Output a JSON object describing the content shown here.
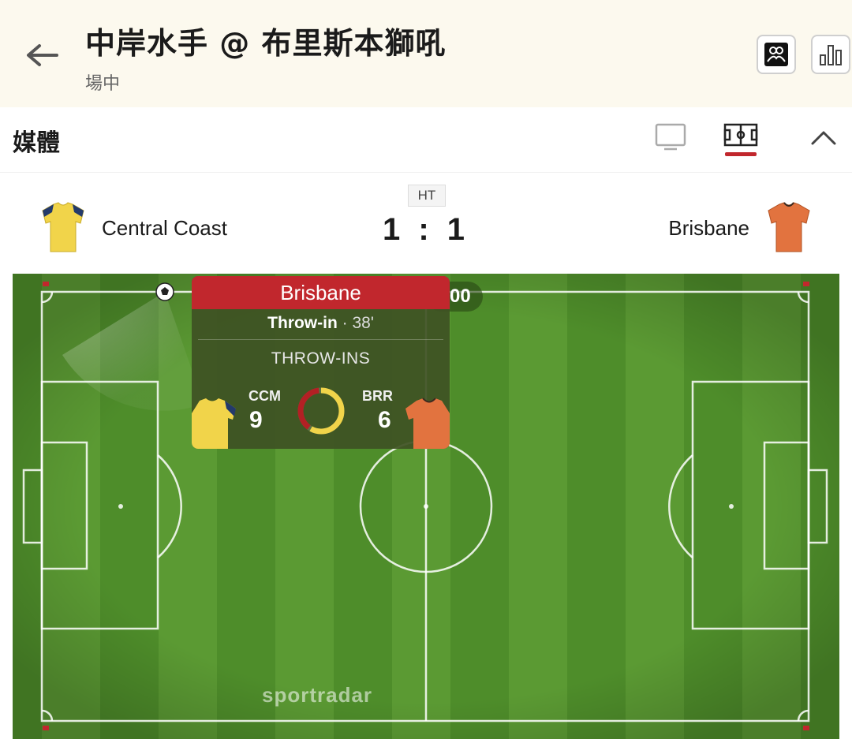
{
  "header": {
    "title": "中岸水手 @ 布里斯本獅吼",
    "status": "場中"
  },
  "header_icons": [
    "back-arrow-icon",
    "lineup-icon",
    "stats-icon"
  ],
  "media": {
    "label": "媒體",
    "icons": [
      "tv-icon",
      "pitch-view-icon",
      "chevron-up-icon"
    ],
    "active_view": "pitch-view"
  },
  "match": {
    "period": "HT",
    "home": {
      "name": "Central Coast",
      "abbr": "CCM",
      "shirt_color": "#f1d44a"
    },
    "away": {
      "name": "Brisbane",
      "abbr": "BRR",
      "shirt_color": "#e2733f"
    },
    "home_score": "1",
    "separator": ":",
    "away_score": "1"
  },
  "popup": {
    "team": "Brisbane",
    "event": "Throw-in",
    "minute": "· 38'",
    "stat_label": "THROW-INS",
    "home_count": "9",
    "away_count": "6",
    "home_fraction": 0.6,
    "away_fraction": 0.4
  },
  "clock_fragment": "00",
  "brand": "sportradar",
  "colors": {
    "accent": "#c1272d",
    "pitch_dark": "#4e8d2a",
    "pitch_light": "#5b9a33",
    "home_ring": "#f1d44a",
    "away_ring": "#b32024"
  }
}
